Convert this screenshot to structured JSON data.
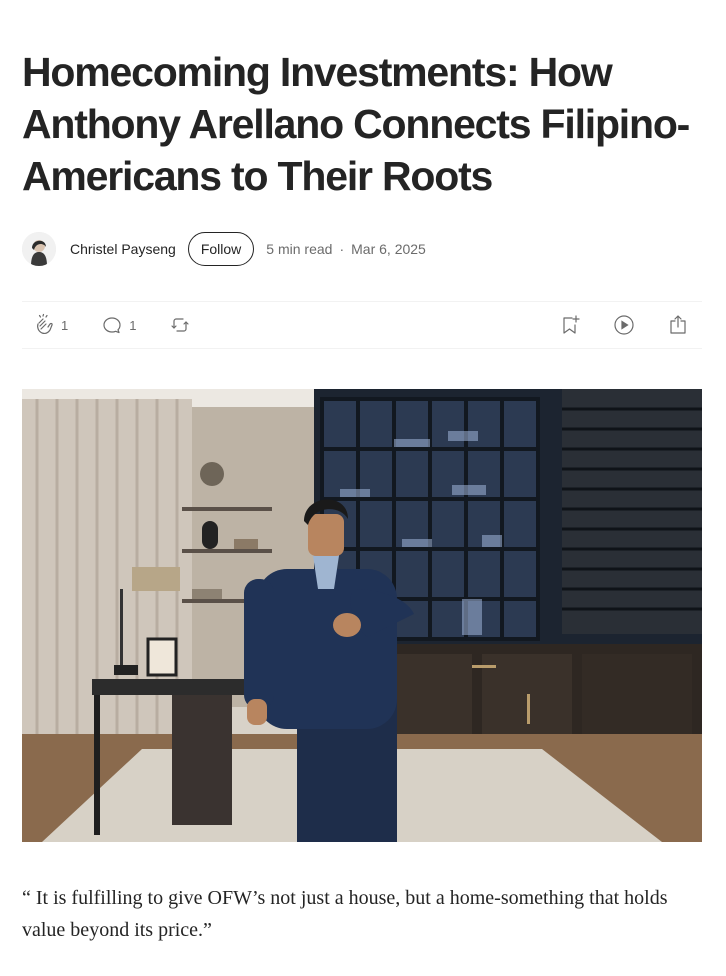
{
  "article": {
    "title": "Homecoming Investments: How Anthony Arellano Connects Filipino-Americans to Their Roots",
    "author": "Christel Payseng",
    "follow_label": "Follow",
    "read_time": "5 min read",
    "separator": "·",
    "date": "Mar 6, 2025",
    "quote": "“ It is fulfilling to give OFW’s not just a house, but a home-something that holds value beyond its price.”"
  },
  "actions": {
    "claps": "1",
    "responses": "1",
    "icons": [
      "clap-icon",
      "comment-icon",
      "repost-icon",
      "bookmark-icon",
      "play-icon",
      "share-icon"
    ]
  },
  "colors": {
    "text": "#242424",
    "muted": "#6b6b6b",
    "divider": "#f2f2f2",
    "cabinet": "#1c2430",
    "shelf_light": "#9fb4d9"
  }
}
